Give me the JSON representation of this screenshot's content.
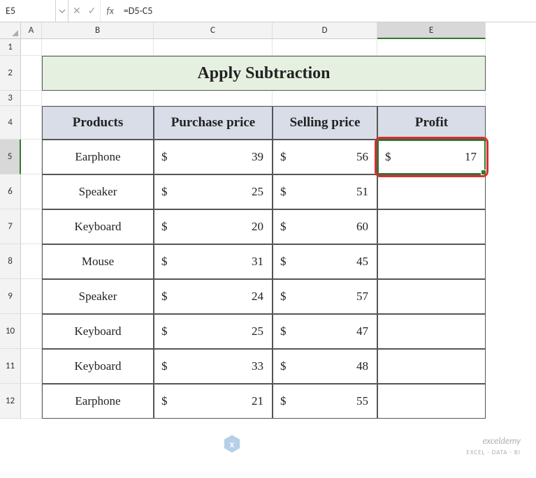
{
  "name_box": "E5",
  "formula": "=D5-C5",
  "columns": [
    "A",
    "B",
    "C",
    "D",
    "E"
  ],
  "rows": [
    "1",
    "2",
    "3",
    "4",
    "5",
    "6",
    "7",
    "8",
    "9",
    "10",
    "11",
    "12"
  ],
  "active_col": "E",
  "active_row": "5",
  "title": "Apply Subtraction",
  "table": {
    "headers": [
      "Products",
      "Purchase price",
      "Selling price",
      "Profit"
    ],
    "currency_symbol": "$",
    "rows": [
      {
        "product": "Earphone",
        "purchase": 39,
        "selling": 56,
        "profit": 17
      },
      {
        "product": "Speaker",
        "purchase": 25,
        "selling": 51,
        "profit": ""
      },
      {
        "product": "Keyboard",
        "purchase": 20,
        "selling": 60,
        "profit": ""
      },
      {
        "product": "Mouse",
        "purchase": 31,
        "selling": 45,
        "profit": ""
      },
      {
        "product": "Speaker",
        "purchase": 24,
        "selling": 57,
        "profit": ""
      },
      {
        "product": "Keyboard",
        "purchase": 25,
        "selling": 47,
        "profit": ""
      },
      {
        "product": "Keyboard",
        "purchase": 33,
        "selling": 48,
        "profit": ""
      },
      {
        "product": "Earphone",
        "purchase": 21,
        "selling": 55,
        "profit": ""
      }
    ]
  },
  "watermark": {
    "brand": "exceldemy",
    "tagline": "EXCEL · DATA · BI"
  },
  "chart_data": {
    "type": "table",
    "title": "Apply Subtraction",
    "columns": [
      "Products",
      "Purchase price",
      "Selling price",
      "Profit"
    ],
    "rows": [
      [
        "Earphone",
        39,
        56,
        17
      ],
      [
        "Speaker",
        25,
        51,
        null
      ],
      [
        "Keyboard",
        20,
        60,
        null
      ],
      [
        "Mouse",
        31,
        45,
        null
      ],
      [
        "Speaker",
        24,
        57,
        null
      ],
      [
        "Keyboard",
        25,
        47,
        null
      ],
      [
        "Keyboard",
        33,
        48,
        null
      ],
      [
        "Earphone",
        21,
        55,
        null
      ]
    ]
  }
}
